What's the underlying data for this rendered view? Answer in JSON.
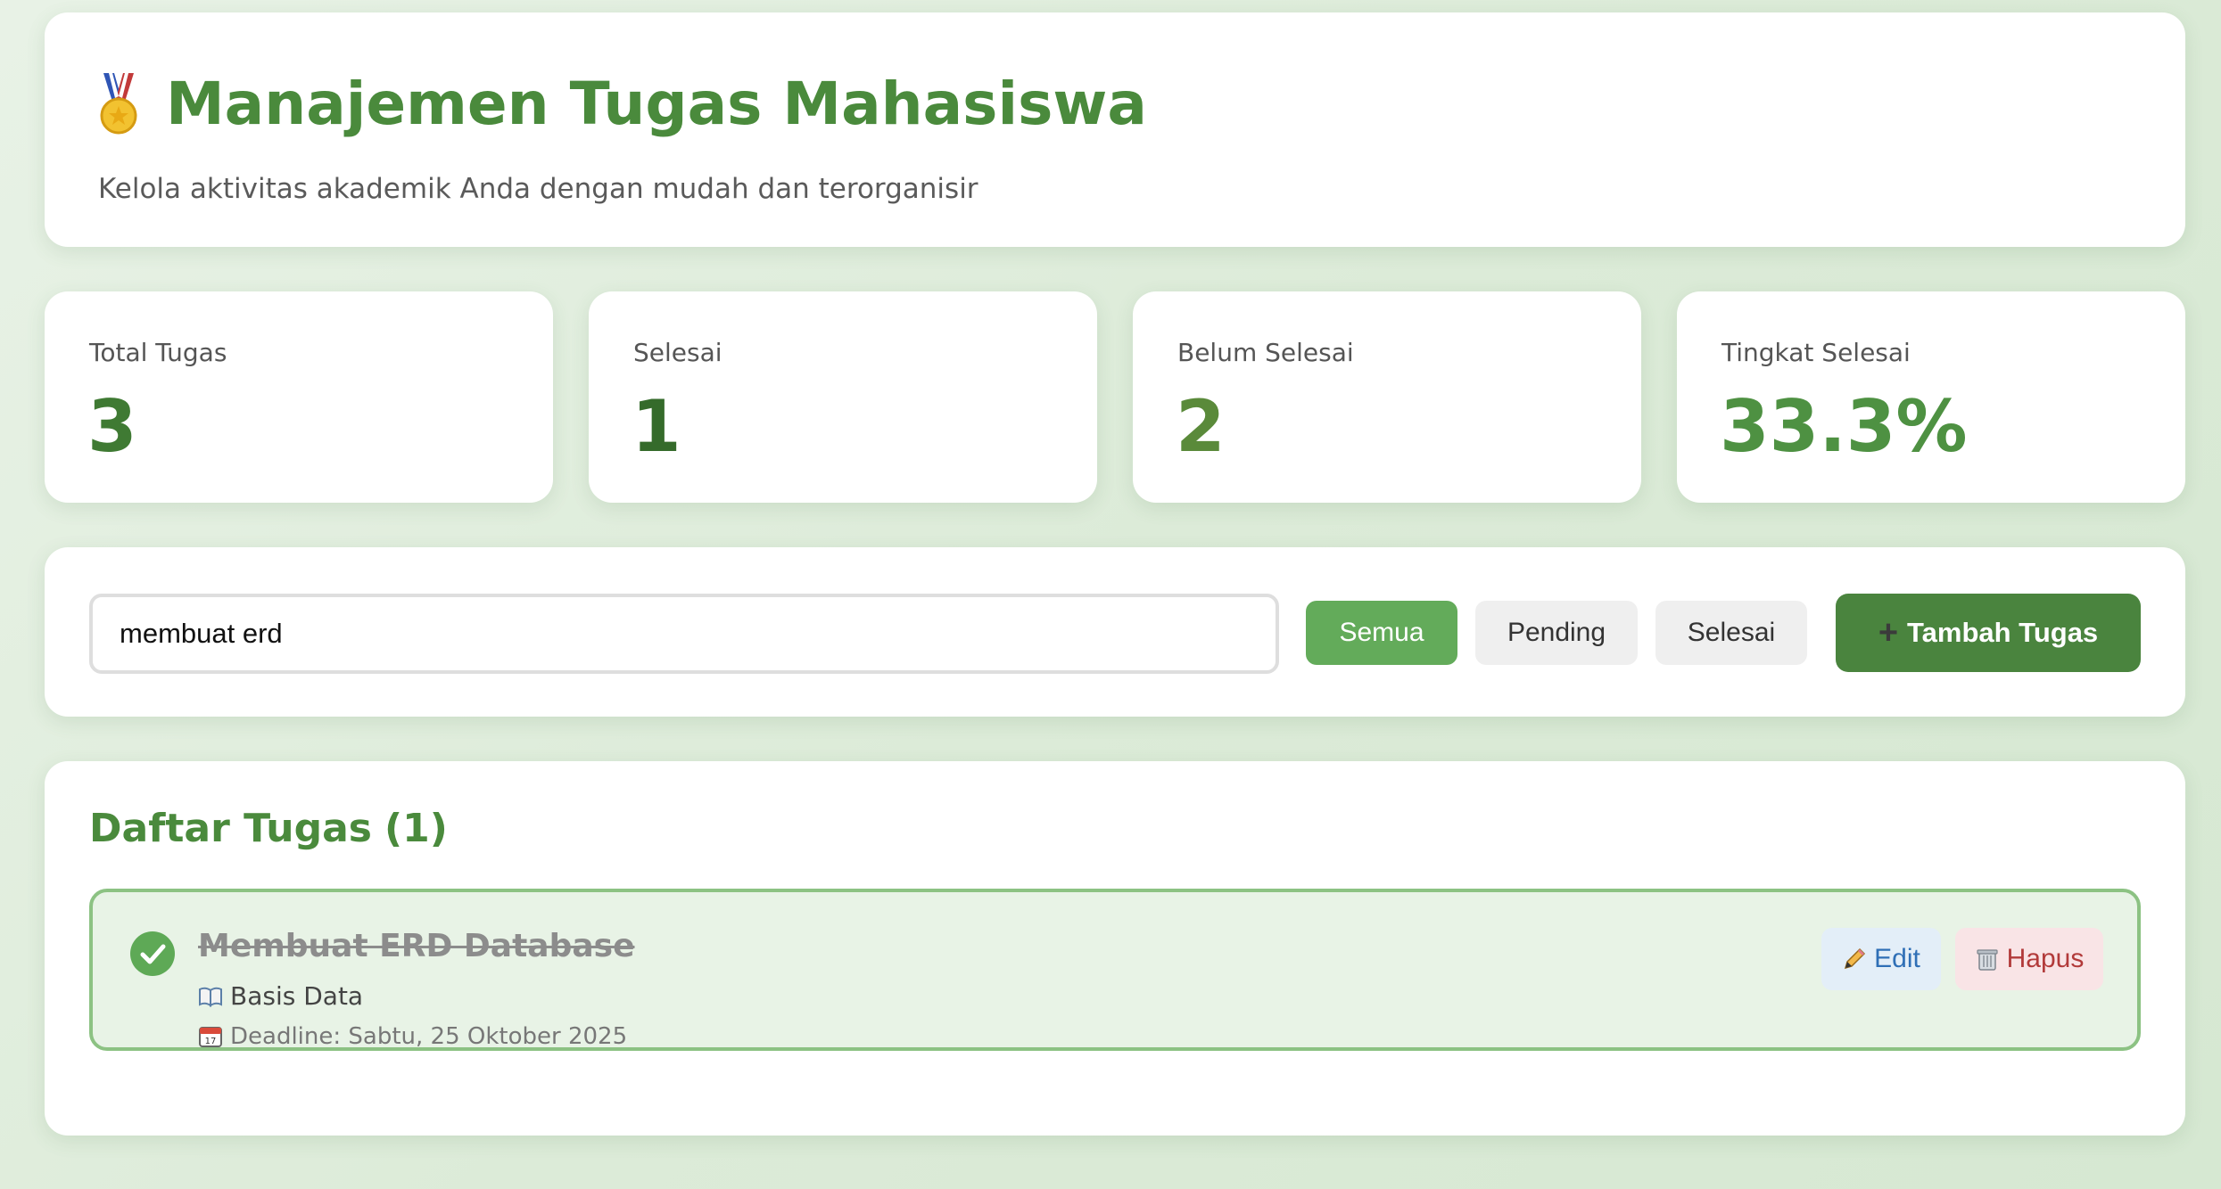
{
  "header": {
    "title": "Manajemen Tugas Mahasiswa",
    "subtitle": "Kelola aktivitas akademik Anda dengan mudah dan terorganisir",
    "icon": "medal-icon"
  },
  "stats": [
    {
      "label": "Total Tugas",
      "value": "3",
      "color": "#3f7a33"
    },
    {
      "label": "Selesai",
      "value": "1",
      "color": "#356b2b"
    },
    {
      "label": "Belum Selesai",
      "value": "2",
      "color": "#5a8a3a"
    },
    {
      "label": "Tingkat Selesai",
      "value": "33.3%",
      "color": "#4e9142"
    }
  ],
  "toolbar": {
    "search_value": "membuat erd",
    "filters": [
      "Semua",
      "Pending",
      "Selesai"
    ],
    "active_filter": "Semua",
    "add_label": "Tambah Tugas"
  },
  "task_list": {
    "title": "Daftar Tugas",
    "count_text": "(1)",
    "tasks": [
      {
        "title": "Membuat ERD Database",
        "course": "Basis Data",
        "deadline": "Deadline: Sabtu, 25 Oktober 2025",
        "completed": true,
        "edit_label": "Edit",
        "delete_label": "Hapus"
      }
    ]
  },
  "colors": {
    "primary": "#4a8a3c",
    "active_filter_bg": "#63ab5a",
    "add_button_bg": "#4a843e"
  }
}
